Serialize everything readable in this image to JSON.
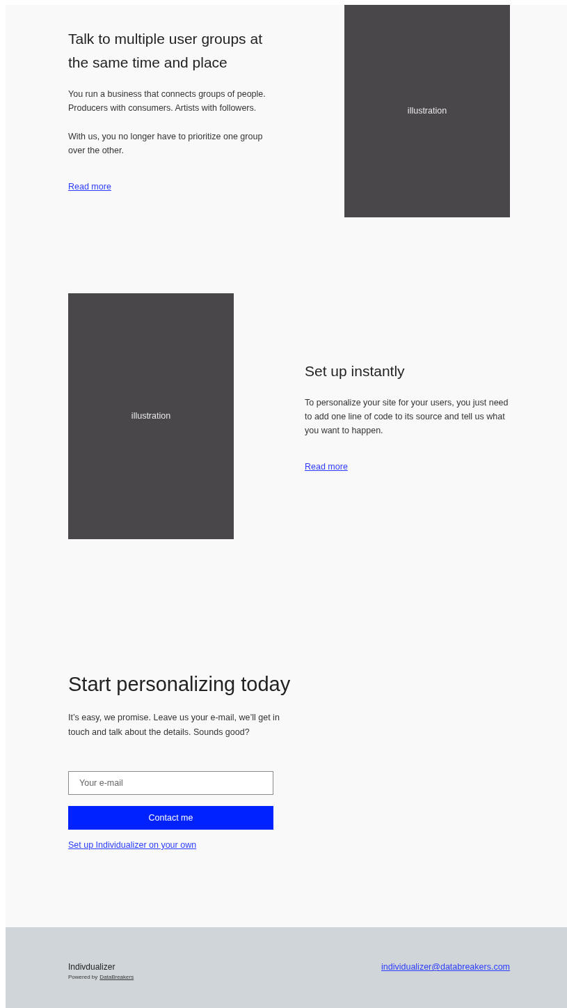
{
  "features": [
    {
      "title": "Talk to multiple user groups at the same time and place",
      "paragraphs": [
        "You run a business that connects groups of people. Producers with consumers. Artists with followers.",
        "With us, you no longer have to prioritize one group over the other."
      ],
      "link": "Read more",
      "illustration": "illustration",
      "kind": "right"
    },
    {
      "title": "Set up instantly",
      "paragraphs": [
        "To personalize your site for your users, you just need to add one line of code to its source and tell us what you want to happen."
      ],
      "link": "Read more",
      "illustration": "illustration",
      "kind": "left"
    }
  ],
  "cta": {
    "title": "Start personalizing today",
    "text": "It’s easy, we promise. Leave us your e-mail, we’ll get in touch and talk about the details. Sounds good?",
    "email_field": {
      "placeholder": "Your e-mail"
    },
    "button": "Contact me",
    "link": "Set up Individualizer on your own"
  },
  "footer": {
    "brand": "Indivdualizer",
    "powered_by": "Powered by",
    "powered_link": "DataBreakers",
    "email": "individualizer@databreakers.com"
  }
}
